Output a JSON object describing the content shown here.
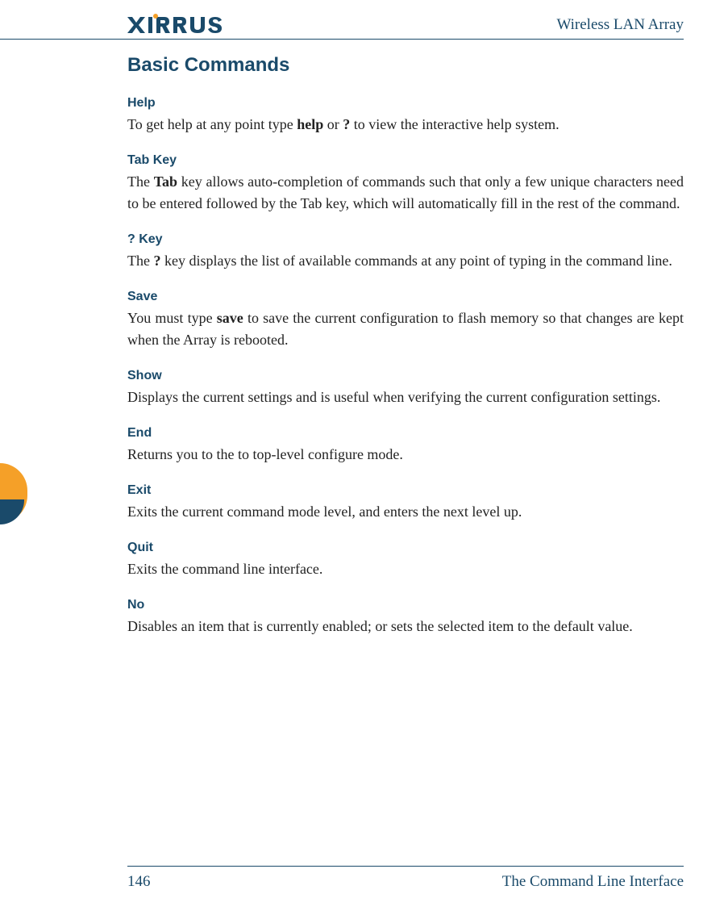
{
  "header": {
    "title": "Wireless LAN Array",
    "logo_text": "XIRRUS"
  },
  "main_heading": "Basic Commands",
  "sections": [
    {
      "heading": "Help",
      "body_pre": "To get help at any point type ",
      "body_bold1": "help",
      "body_mid": " or ",
      "body_bold2": "?",
      "body_post": " to view the interactive help system."
    },
    {
      "heading": "Tab Key",
      "body_pre": "The ",
      "body_bold1": "Tab",
      "body_post": " key allows auto-completion of commands such that only a few unique characters need to be entered followed by the Tab key, which will automatically fill in the rest of the command."
    },
    {
      "heading": "? Key",
      "body_pre": "The ",
      "body_bold1": "?",
      "body_post": " key displays the list of available commands at any point of typing in the command line."
    },
    {
      "heading": "Save",
      "body_pre": "You must type ",
      "body_bold1": "save",
      "body_post": " to save the current configuration to flash memory so that changes are kept when the Array is rebooted."
    },
    {
      "heading": "Show",
      "body_plain": "Displays the current settings and is useful when verifying the current configuration settings."
    },
    {
      "heading": "End",
      "body_plain": "Returns you to the to top-level configure mode."
    },
    {
      "heading": "Exit",
      "body_plain": "Exits the current command mode level, and enters the next level up."
    },
    {
      "heading": "Quit",
      "body_plain": "Exits the command line interface."
    },
    {
      "heading": "No",
      "body_plain": "Disables an item that is currently enabled; or sets the selected item to the default value."
    }
  ],
  "footer": {
    "page_number": "146",
    "title": "The Command Line Interface"
  }
}
